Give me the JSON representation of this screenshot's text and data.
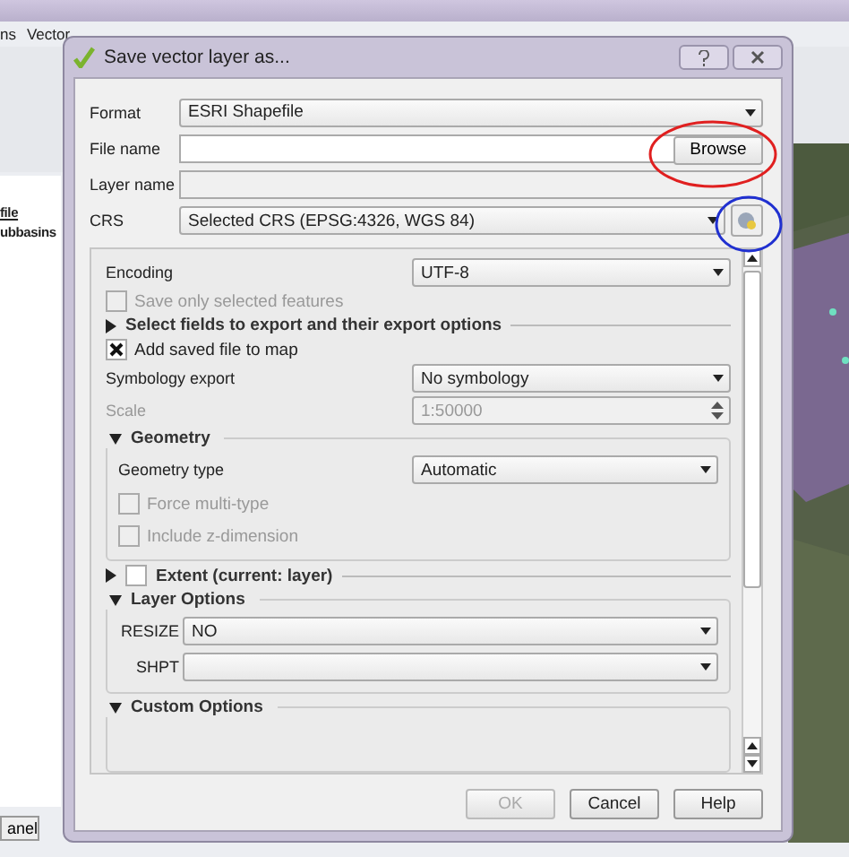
{
  "app": {
    "menu": [
      "ns",
      "Vector"
    ],
    "layers": [
      {
        "label": "file",
        "underlined": true
      },
      {
        "label": "ubbasins",
        "underlined": false
      }
    ],
    "panel_button": "anel"
  },
  "dialog": {
    "title": "Save vector layer as...",
    "fields": [
      {
        "kind": "select",
        "label": "Format",
        "value": "ESRI Shapefile"
      },
      {
        "kind": "file",
        "label": "File name",
        "button": "Browse"
      },
      {
        "kind": "text",
        "label": "Layer name",
        "disabled": true
      },
      {
        "kind": "crs",
        "label": "CRS",
        "value": "Selected CRS (EPSG:4326, WGS 84)"
      }
    ],
    "options": [
      {
        "kind": "select",
        "label": "Encoding",
        "value": "UTF-8"
      },
      {
        "kind": "checkbox",
        "label": "Save only selected features",
        "checked": false,
        "disabled": true
      },
      {
        "kind": "section",
        "title": "Select fields to export and their export options",
        "expanded": false
      },
      {
        "kind": "checkbox",
        "label": "Add saved file to map",
        "checked": true,
        "disabled": false
      },
      {
        "kind": "select",
        "label": "Symbology export",
        "value": "No symbology"
      },
      {
        "kind": "spin",
        "label": "Scale",
        "value": "1:50000",
        "disabled": true
      },
      {
        "kind": "group",
        "title": "Geometry",
        "expanded": true,
        "items": [
          {
            "kind": "select",
            "label": "Geometry type",
            "value": "Automatic"
          },
          {
            "kind": "checkbox",
            "label": "Force multi-type",
            "checked": false,
            "disabled": true
          },
          {
            "kind": "checkbox",
            "label": "Include z-dimension",
            "checked": false,
            "disabled": true
          }
        ]
      },
      {
        "kind": "section",
        "title": "Extent (current: layer)",
        "expanded": false,
        "checked": false
      },
      {
        "kind": "group",
        "title": "Layer Options",
        "expanded": true,
        "items": [
          {
            "kind": "option",
            "label": "RESIZE",
            "value": "NO"
          },
          {
            "kind": "option",
            "label": "SHPT"
          }
        ]
      },
      {
        "kind": "group",
        "title": "Custom Options",
        "expanded": true
      }
    ],
    "buttons": [
      {
        "label": "OK",
        "disabled": true
      },
      {
        "label": "Cancel",
        "disabled": false
      },
      {
        "label": "Help",
        "disabled": false
      }
    ]
  }
}
